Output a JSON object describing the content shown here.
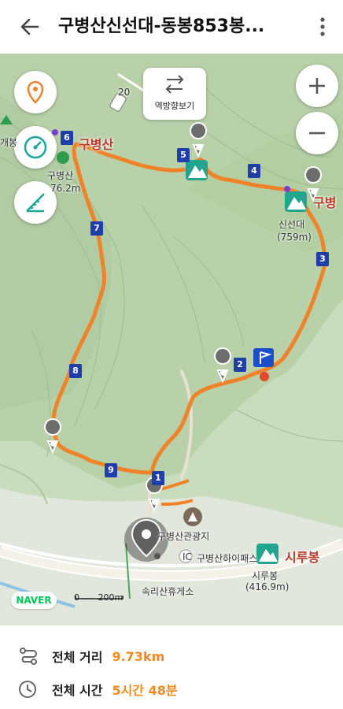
{
  "header": {
    "title": "구병산신선대-동봉853봉...",
    "back_icon": "back-arrow-icon",
    "more_icon": "more-vertical-icon"
  },
  "map": {
    "reverse_button_label": "역방향보기",
    "route_color": "#f0832a",
    "peaks": [
      {
        "name": "구병산",
        "elevation": "76.2m"
      },
      {
        "name": "신선대",
        "elevation": "(759m)"
      },
      {
        "name": "시루봉",
        "elevation": "(416.9m)"
      }
    ],
    "peak_titles": [
      "구병산",
      "구병",
      "시루봉"
    ],
    "places": [
      "구병산관광지",
      "구병산하이패스",
      "속리산휴게소",
      "개봉",
      "IC"
    ],
    "waypoints": [
      "1",
      "2",
      "3",
      "4",
      "5",
      "6",
      "7",
      "8",
      "9"
    ],
    "road_label": "20",
    "logo": "NAVER",
    "scale": {
      "zero": "0",
      "distance": "200m"
    }
  },
  "summary": {
    "distance_label": "전체 거리",
    "distance_value": "9.73km",
    "time_label": "전체 시간",
    "time_value": "5시간 48분"
  }
}
